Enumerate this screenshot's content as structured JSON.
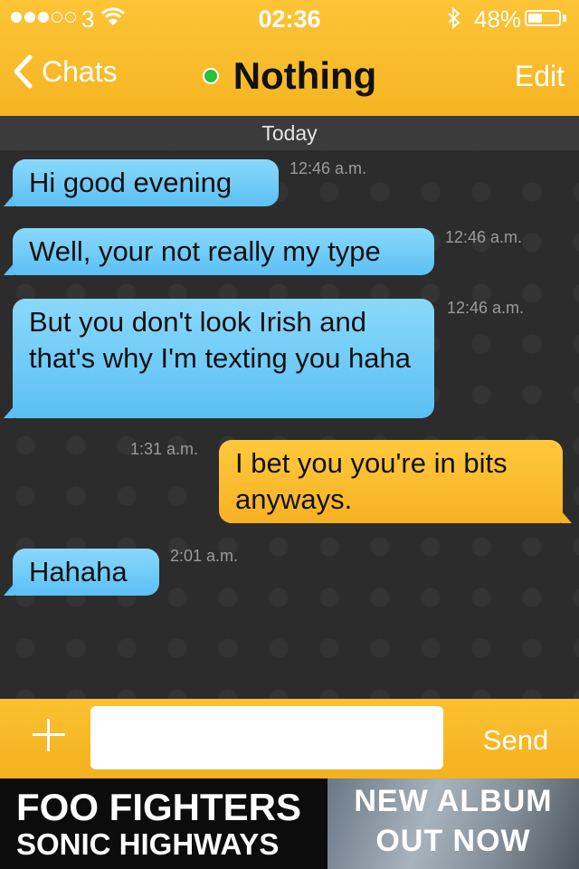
{
  "status_bar": {
    "carrier": "3",
    "time": "02:36",
    "battery_text": "48%",
    "battery_level": 0.48
  },
  "nav": {
    "back_label": "Chats",
    "title": "Nothing",
    "edit_label": "Edit",
    "online_color": "#25c23a"
  },
  "chat": {
    "date_label": "Today",
    "messages": [
      {
        "from": "them",
        "text": "Hi good evening",
        "time": "12:46 a.m."
      },
      {
        "from": "them",
        "text": "Well, your not really my type",
        "time": "12:46 a.m."
      },
      {
        "from": "them",
        "text": "But you don't look Irish and that's why I'm texting you haha",
        "time": "12:46 a.m."
      },
      {
        "from": "me",
        "text": "I bet you you're in bits anyways.",
        "time": "1:31 a.m."
      },
      {
        "from": "them",
        "text": "Hahaha",
        "time": "2:01 a.m."
      }
    ]
  },
  "composer": {
    "value": "",
    "placeholder": "",
    "send_label": "Send",
    "add_icon": "plus-icon"
  },
  "ad": {
    "line1": "FOO FIGHTERS",
    "line2": "SONIC HIGHWAYS",
    "line3": "NEW ALBUM",
    "line4": "OUT NOW"
  },
  "colors": {
    "accent": "#f8b727",
    "incoming_bubble": "#6fc9f7",
    "outgoing_bubble": "#fbbd30"
  }
}
